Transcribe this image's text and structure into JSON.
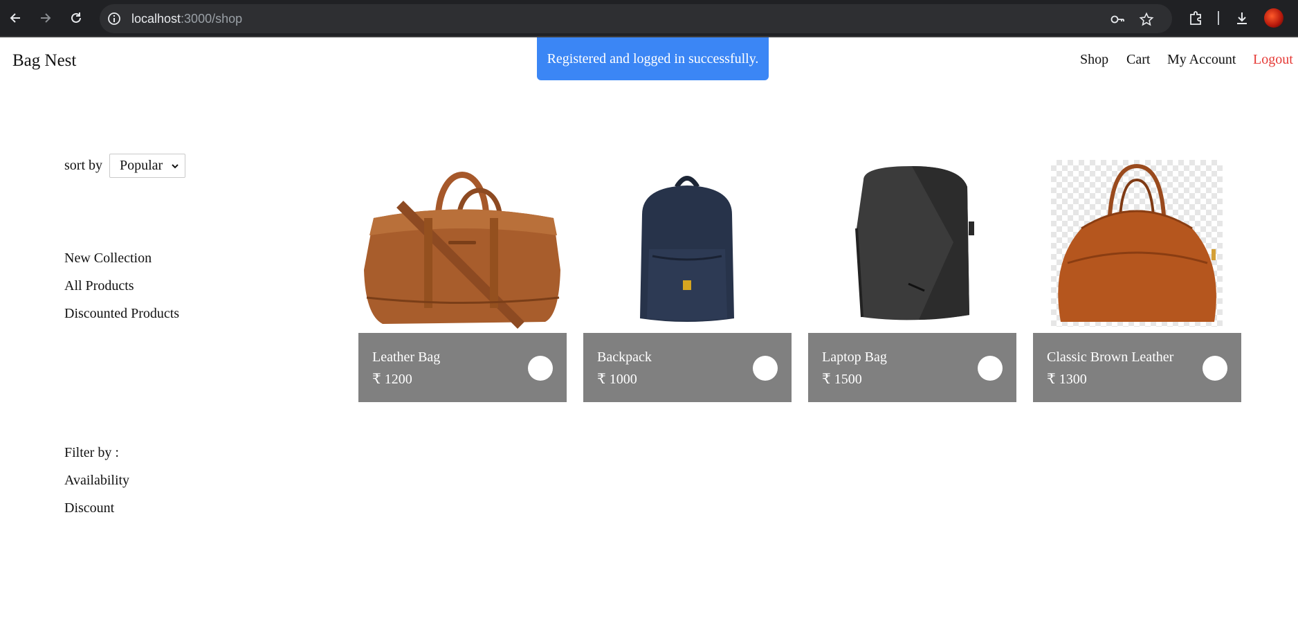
{
  "browser": {
    "url_host": "localhost",
    "url_path": ":3000/shop"
  },
  "header": {
    "brand": "Bag Nest",
    "nav": {
      "shop": "Shop",
      "cart": "Cart",
      "account": "My Account",
      "logout": "Logout"
    }
  },
  "toast": {
    "message": "Registered and logged in successfully."
  },
  "sidebar": {
    "sort_label": "sort by",
    "sort_selected": "Popular",
    "links": {
      "new_collection": "New Collection",
      "all_products": "All Products",
      "discounted_products": "Discounted Products"
    },
    "filter": {
      "heading": "Filter by :",
      "availability": "Availability",
      "discount": "Discount"
    }
  },
  "products": [
    {
      "name": "Leather Bag",
      "price": "₹ 1200"
    },
    {
      "name": "Backpack",
      "price": "₹ 1000"
    },
    {
      "name": "Laptop Bag",
      "price": "₹ 1500"
    },
    {
      "name": "Classic Brown Leather",
      "price": "₹ 1300"
    }
  ],
  "colors": {
    "toast_bg": "#3b86f5",
    "card_info_bg": "#808080",
    "logout": "#e53935"
  }
}
